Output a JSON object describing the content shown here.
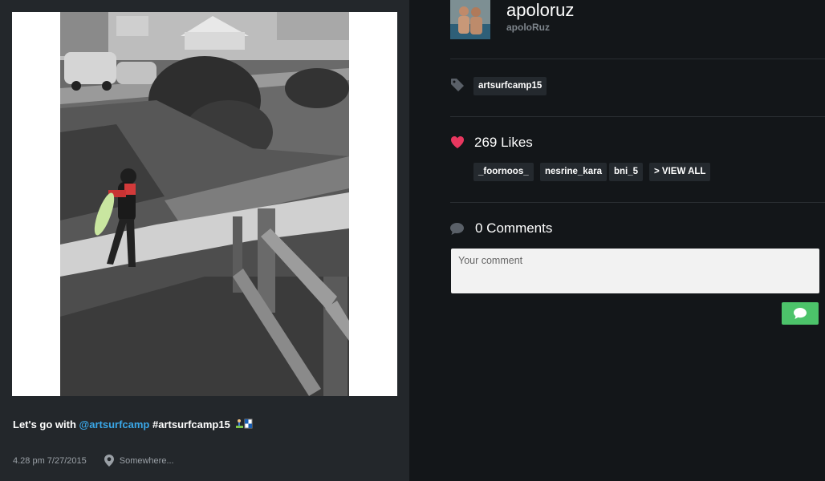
{
  "post": {
    "caption": {
      "text_prefix": "Let's go with ",
      "mention": "@artsurfcamp",
      "hashtag": "#artsurfcamp15",
      "emoji_icon": "surfer-flag-emoji"
    },
    "time": "4.28 pm 7/27/2015",
    "location": "Somewhere..."
  },
  "user": {
    "name": "apoloruz",
    "handle": "apoloRuz"
  },
  "tags": [
    "artsurfcamp15"
  ],
  "likes": {
    "label": "269 Likes",
    "likers": [
      "_foornoos_",
      "nesrine_kara",
      "bni_5"
    ],
    "view_all_label": "> VIEW ALL"
  },
  "comments": {
    "label": "0 Comments",
    "placeholder": "Your comment"
  },
  "colors": {
    "accent_link": "#3aa7e8",
    "heart": "#e8375f",
    "send_button": "#4cc36a",
    "panel_left": "#23272b",
    "panel_right": "#131619"
  }
}
